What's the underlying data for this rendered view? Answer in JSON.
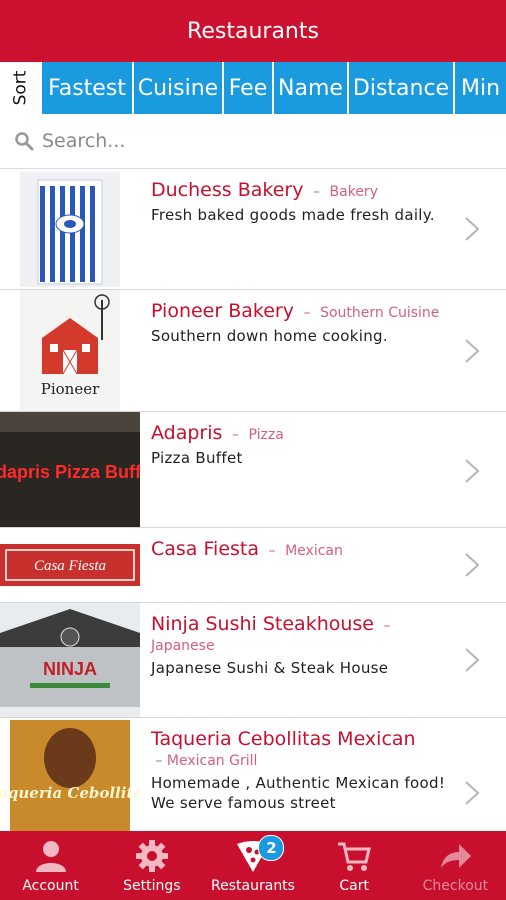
{
  "header": {
    "title": "Restaurants"
  },
  "sort": {
    "label": "Sort",
    "options": [
      "Fastest",
      "Cuisine",
      "Fee",
      "Name",
      "Distance",
      "Min"
    ]
  },
  "search": {
    "placeholder": "Search..."
  },
  "restaurants": [
    {
      "name": "Duchess Bakery",
      "category": "Bakery",
      "description": "Fresh baked goods made fresh daily.",
      "thumb_sign": ""
    },
    {
      "name": "Pioneer Bakery",
      "category": "Southern Cuisine",
      "description": "Southern down home cooking.",
      "thumb_sign": "Pioneer"
    },
    {
      "name": "Adapris",
      "category": "Pizza",
      "description": "Pizza Buffet",
      "thumb_sign": "Adapris Pizza Buffet"
    },
    {
      "name": "Casa Fiesta",
      "category": "Mexican",
      "description": "",
      "thumb_sign": "Casa Fiesta"
    },
    {
      "name": "Ninja Sushi Steakhouse",
      "category": "Japanese",
      "description": "Japanese Sushi & Steak House",
      "thumb_sign": "NINJA"
    },
    {
      "name": "Taqueria Cebollitas Mexican",
      "category": "Mexican Grill",
      "description": "Homemade , Authentic Mexican food! We serve famous street",
      "thumb_sign": "Taqueria Cebollitas"
    }
  ],
  "tabs": [
    {
      "label": "Account",
      "icon": "user-icon"
    },
    {
      "label": "Settings",
      "icon": "gear-icon"
    },
    {
      "label": "Restaurants",
      "icon": "pizza-icon",
      "badge": "2"
    },
    {
      "label": "Cart",
      "icon": "cart-icon"
    },
    {
      "label": "Checkout",
      "icon": "arrow-forward-icon"
    }
  ],
  "colors": {
    "brand_red": "#c8102e",
    "sort_blue": "#1a9be0"
  }
}
